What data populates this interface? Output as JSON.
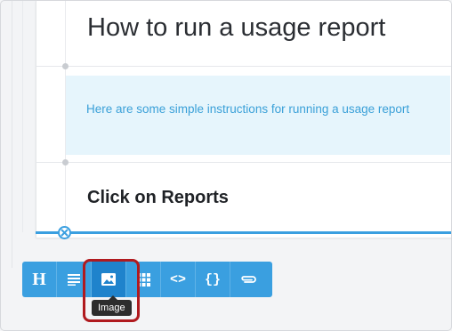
{
  "document": {
    "title": "How to run a usage report",
    "callout_text": "Here are some simple instructions for running a usage report",
    "step_heading": "Click on Reports"
  },
  "toolbar": {
    "heading_label": "H",
    "code_label": "<>",
    "braces_label": "{}",
    "tooltip": "Image",
    "active_item": "image"
  },
  "colors": {
    "accent": "#3a9fe0",
    "accent_active": "#1f83cc",
    "callout_bg": "#e6f5fc",
    "callout_text": "#3aa0d8",
    "highlight": "#b01a1f"
  }
}
